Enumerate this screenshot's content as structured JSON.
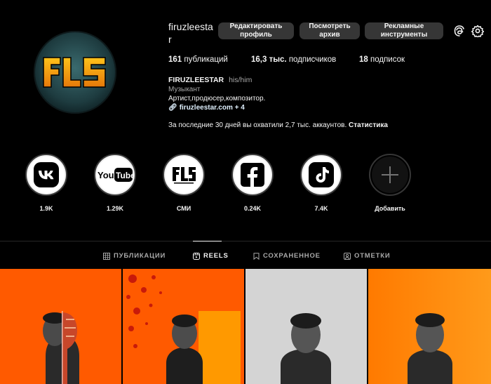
{
  "profile": {
    "username": "firuzleestar",
    "buttons": [
      "Редактировать профиль",
      "Посмотреть архив",
      "Рекламные инструменты"
    ],
    "stats": {
      "posts_num": "161",
      "posts_label": "публикаций",
      "followers_num": "16,3 тыс.",
      "followers_label": "подписчиков",
      "following_num": "18",
      "following_label": "подписок"
    },
    "name": "FIRUZLEESTAR",
    "pronouns": "his/him",
    "category": "Музыкант",
    "bio": "Артист,продюсер,композитор.",
    "link": "firuzleestar.com + 4",
    "insights_text": "За последние 30 дней вы охватили 2,7 тыс. аккаунтов.",
    "insights_link": "Статистика",
    "avatar_logo_text": "FLS"
  },
  "highlights": [
    {
      "label": "1.9K",
      "icon": "vk-icon",
      "glyph": "VK"
    },
    {
      "label": "1.29K",
      "icon": "youtube-icon",
      "glyph": "YouTube"
    },
    {
      "label": "СМИ",
      "icon": "fls-logo-icon",
      "glyph": "FLS"
    },
    {
      "label": "0.24K",
      "icon": "facebook-icon",
      "glyph": "f"
    },
    {
      "label": "7.4K",
      "icon": "tiktok-icon",
      "glyph": "♪"
    },
    {
      "label": "Добавить",
      "icon": "plus-icon",
      "glyph": "+"
    }
  ],
  "tabs": [
    {
      "label": "ПУБЛИКАЦИИ",
      "icon": "grid-icon"
    },
    {
      "label": "REELS",
      "icon": "reels-icon"
    },
    {
      "label": "СОХРАНЕННОЕ",
      "icon": "bookmark-icon"
    },
    {
      "label": "ОТМЕТКИ",
      "icon": "tagged-icon"
    }
  ],
  "active_tab": "REELS",
  "colors": {
    "background": "#000000",
    "button": "#363636",
    "muted_text": "#a8a8a8",
    "link": "#e0f1ff",
    "avatar_ring": "#1c3b3f",
    "logo_gold": "#f2a20c",
    "tile_orange": "#ff5a00",
    "tile_gray": "#cfcfcf"
  }
}
